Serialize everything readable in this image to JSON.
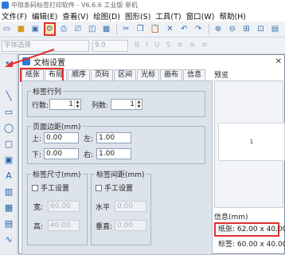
{
  "app": {
    "title": "中琅条码标签打印软件 - V6.6.6 工业版 单机"
  },
  "menu": [
    "文件(F)",
    "编辑(E)",
    "查看(V)",
    "绘图(D)",
    "图形(S)",
    "工具(T)",
    "窗口(W)",
    "帮助(H)"
  ],
  "toolbar2": {
    "font_placeholder": "字体选择",
    "size_value": "9.0"
  },
  "dialog": {
    "title": "文档设置",
    "tabs": [
      "纸张",
      "布局",
      "顺序",
      "页码",
      "区间",
      "光标",
      "画布",
      "信息"
    ],
    "label_rows": {
      "title": "标签行列",
      "rows_label": "行数:",
      "rows_value": "1",
      "cols_label": "列数:",
      "cols_value": "1"
    },
    "margins": {
      "title": "页面边距(mm)",
      "top_label": "上:",
      "top_value": "0.00",
      "left_label": "左:",
      "left_value": "1.00",
      "bottom_label": "下:",
      "bottom_value": "0.00",
      "right_label": "右:",
      "right_value": "1.00"
    },
    "label_size": {
      "title": "标签尺寸(mm)",
      "manual_label": "手工设置",
      "width_label": "宽:",
      "width_value": "60.00",
      "height_label": "高:",
      "height_value": "40.00"
    },
    "label_gap": {
      "title": "标签间距(mm)",
      "manual_label": "手工设置",
      "h_label": "水平",
      "h_value": "0.00",
      "v_label": "垂直:",
      "v_value": "0.00"
    },
    "preview": {
      "title": "预览",
      "label_text": "1"
    },
    "info": {
      "title": "信息(mm)",
      "paper": "纸张: 62.00 x 40.00",
      "label": "标签: 60.00 x 40.00"
    }
  },
  "colors": {
    "highlight": "#e03030",
    "accent": "#2a7bd8"
  }
}
